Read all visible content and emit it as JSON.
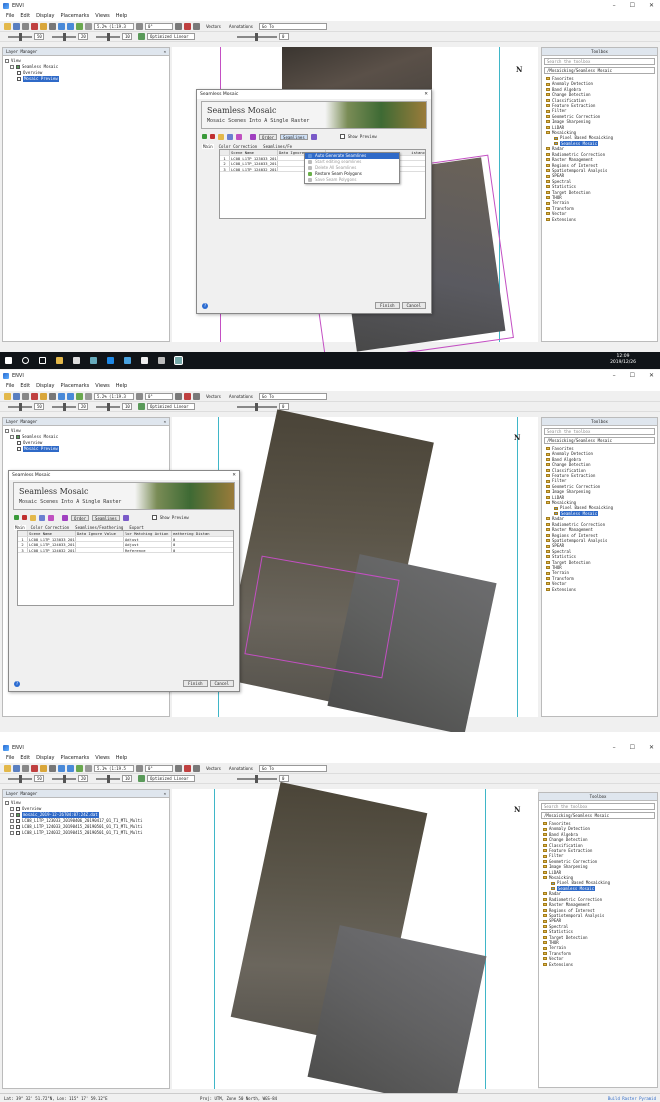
{
  "app": {
    "title": "ENVI",
    "menu": [
      "File",
      "Edit",
      "Display",
      "Placemarks",
      "Views",
      "Help"
    ],
    "zoom_value": "5.2% (1:19.3",
    "zoom_value_3": "5.1% (1:19.5",
    "rotation_value": "0°",
    "stretch_value": "Optimized Linear",
    "vectors_label": "Vectors",
    "annotations_label": "Annotations",
    "goto_label": "Go To",
    "brightness_value": "50",
    "contrast_value": "20",
    "sharpen_value": "10",
    "transparency_value": "0"
  },
  "layer_manager": {
    "title": "Layer Manager",
    "view_label": "View",
    "mosaic_label": "Seamless Mosaic",
    "overview_label": "Overview",
    "mosaic_preview_label": "Mosaic Preview",
    "panel3_items": [
      "Overview",
      "mosaic_2019-12-26T04:07:24Z.dat",
      "LC08_L1TP_123033_20190406_20190417_01_T1_MTL_Multi",
      "LC08_L1TP_124033_20190415_20190501_01_T1_MTL_Multi",
      "LC08_L1TP_124032_20190415_20190501_01_T1_MTL_Multi"
    ]
  },
  "toolbox": {
    "title": "Toolbox",
    "search_placeholder": "Search the toolbox",
    "path": "/Mosaicking/Seamless Mosaic",
    "items": [
      "Favorites",
      "Anomaly Detection",
      "Band Algebra",
      "Change Detection",
      "Classification",
      "Feature Extraction",
      "Filter",
      "Geometric Correction",
      "Image Sharpening",
      "LiDAR",
      "Mosaicking",
      "Radar",
      "Radiometric Correction",
      "Raster Management",
      "Regions of Interest",
      "Spatiotemporal Analysis",
      "SPEAR",
      "Spectral",
      "Statistics",
      "Target Detection",
      "THOR",
      "Terrain",
      "Transform",
      "Vector",
      "Extensions"
    ],
    "mosaic_sub": [
      "Pixel Based Mosaicking",
      "Seamless Mosaic"
    ]
  },
  "dialog": {
    "window_title": "Seamless Mosaic",
    "banner_title": "Seamless Mosaic",
    "banner_subtitle": "Mosaic Scenes Into A Single Raster",
    "order_label": "Order",
    "seamlines_label": "Seamlines",
    "show_preview_label": "Show Preview",
    "tab_main": "Main",
    "tab_color": "Color Correction",
    "tab_seam": "Seamlines/Feathering",
    "tab_export": "Export",
    "tab_seam_cut": "Seamlines/Fe",
    "col_scene": "Scene Name",
    "col_ignore": "Data Ignore Value",
    "col_ignore_cut": "Data Ignore",
    "col_match": "Color Matching Action",
    "col_match_cut": "lor Matching Action",
    "col_feather": "Feathering Distance",
    "col_feather_cut": "eathering Distan",
    "col_distance_cut": "istanc",
    "rows": [
      {
        "n": "1",
        "scene": "LC08_L1TP_123033_2019 00",
        "action": "Adjust",
        "dist": "0"
      },
      {
        "n": "2",
        "scene": "LC08_L1TP_124033_2019 00",
        "action": "Adjust",
        "dist": "0"
      },
      {
        "n": "3",
        "scene": "LC08_L1TP_124032_2019 00",
        "action": "Reference",
        "dist": "0"
      }
    ],
    "finish_label": "Finish",
    "cancel_label": "Cancel",
    "help_glyph": "?"
  },
  "seamlines_menu": [
    "Auto Generate Seamlines",
    "Start editing seamlines",
    "Delete All Seamlines",
    "Restore Seam Polygons",
    "Save Seam Polygons"
  ],
  "taskbar": {
    "time": "12:09",
    "date": "2019/12/26"
  },
  "statusbar": {
    "latlon": "Lat: 39° 32' 51.72\"N, Lon: 115° 17' 59.12\"E",
    "proj": "Proj: UTM, Zone 50 North, WGS-84",
    "right": "Build Raster Pyramid"
  },
  "north_glyph": "N",
  "window_controls": [
    "–",
    "☐",
    "✕"
  ],
  "colors": {
    "accent": "#2f6ac8",
    "seam": "#c34fc3",
    "extent": "#3fb6c8"
  }
}
